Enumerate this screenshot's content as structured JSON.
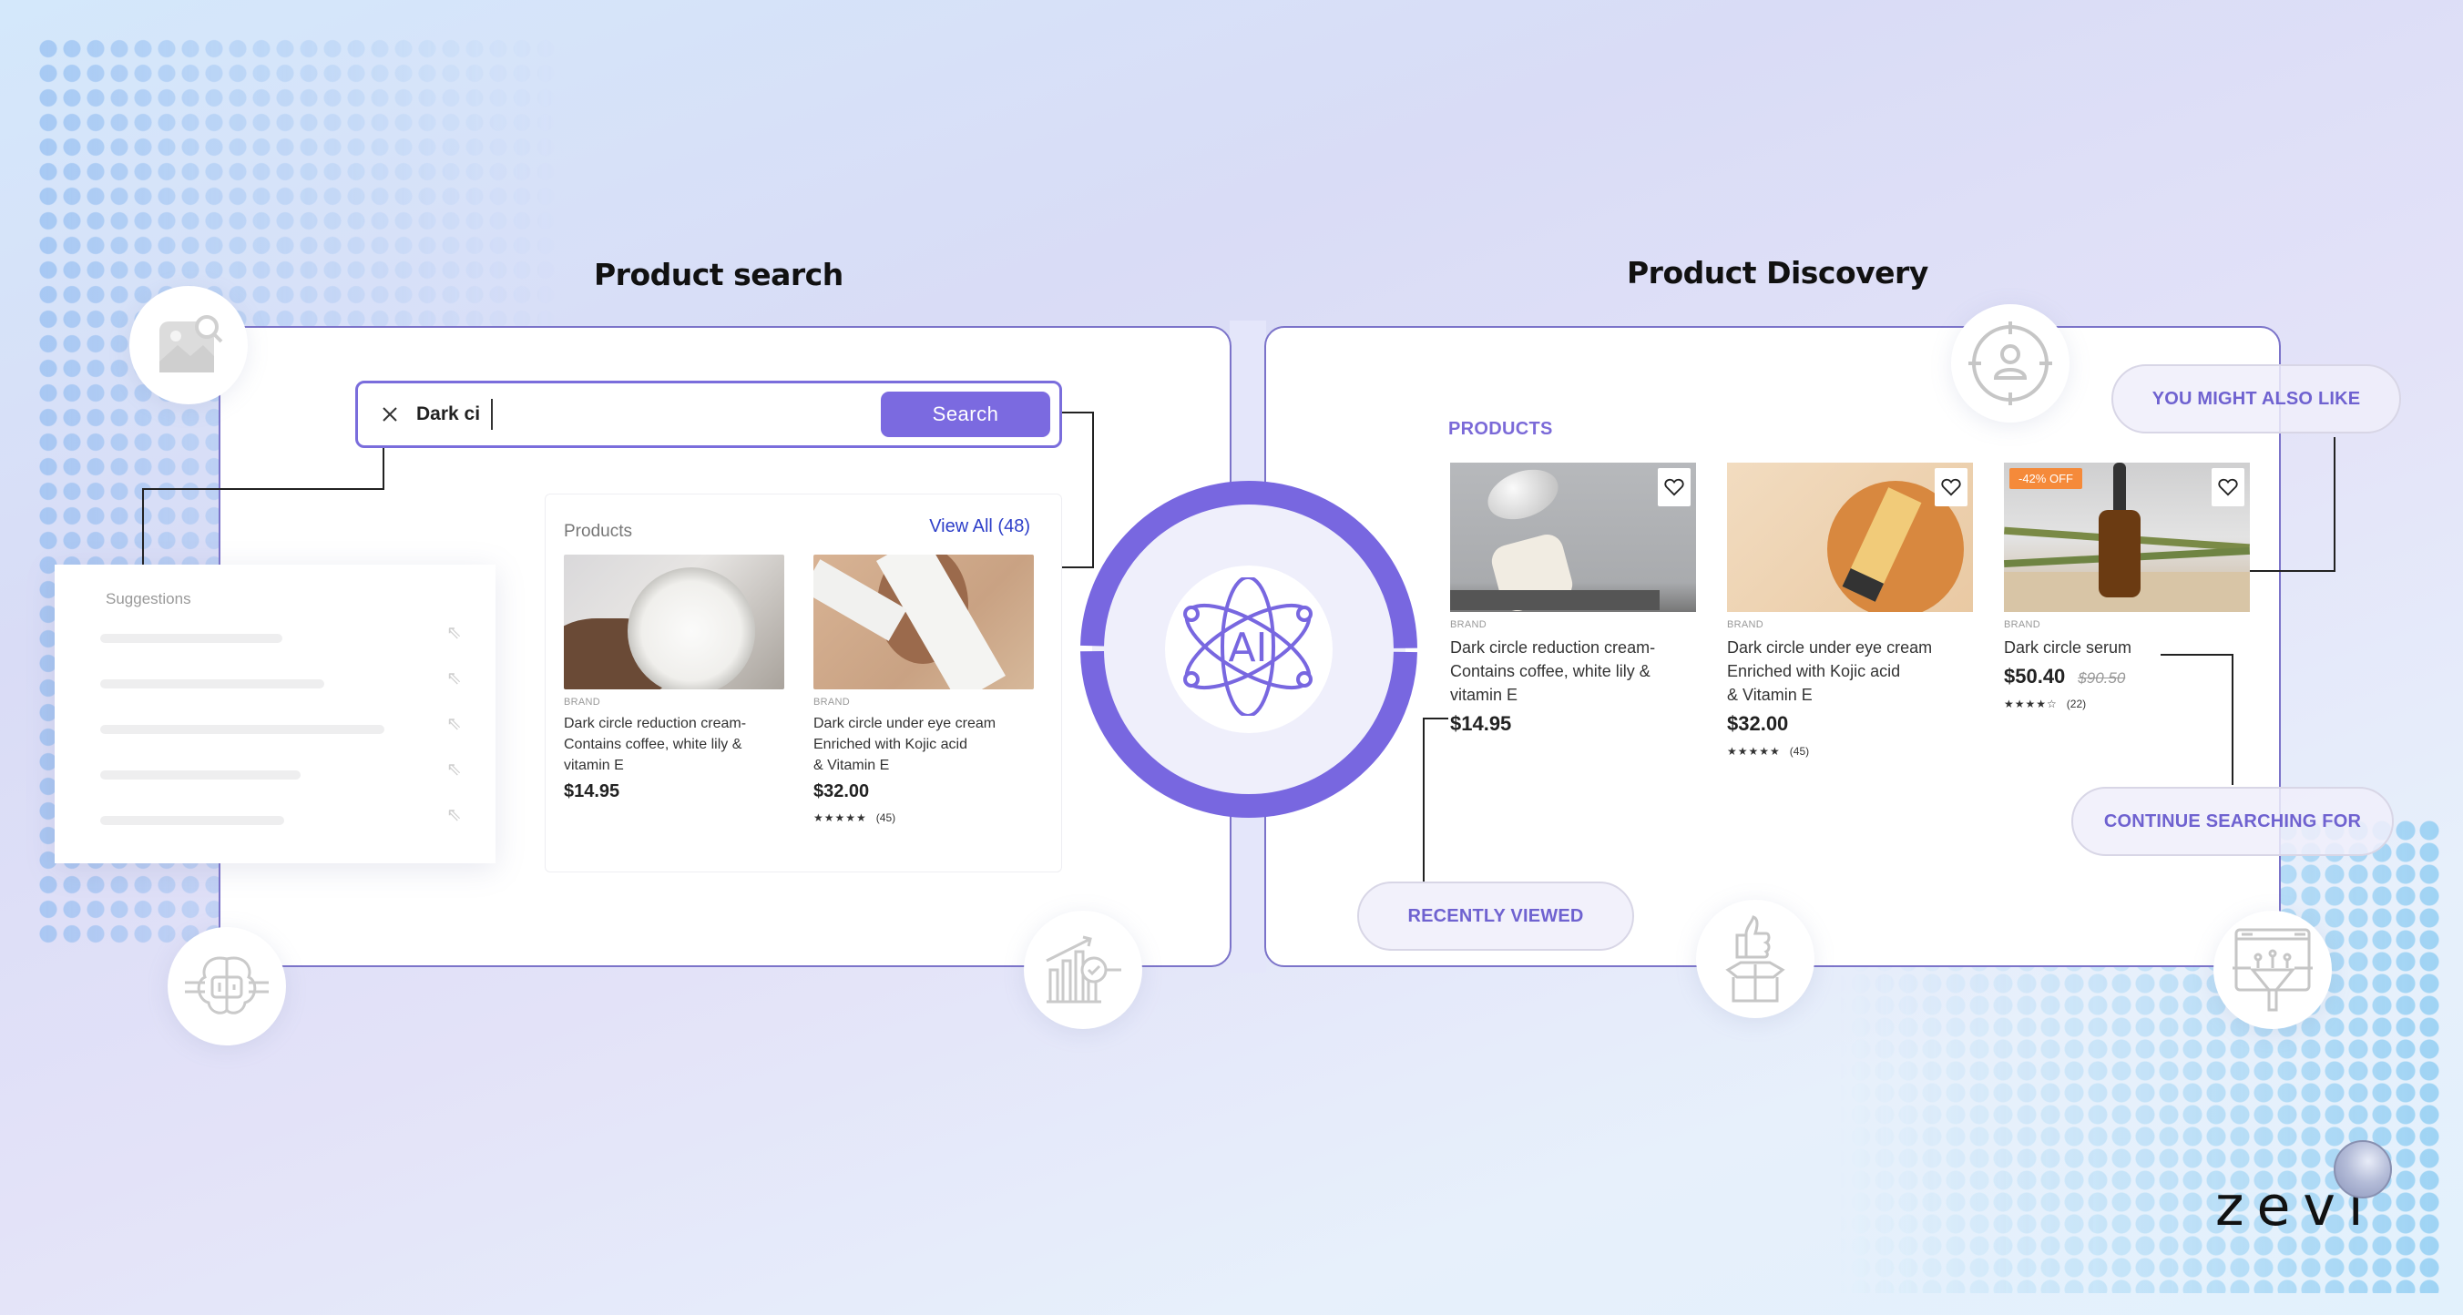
{
  "colors": {
    "accent": "#7b6ae0",
    "panel_border": "#7b73c9",
    "link": "#2e3fc9",
    "discount_badge": "#f58a3a",
    "icon_gray": "#c8c8cc"
  },
  "product_search": {
    "title": "Product search",
    "search": {
      "value": "Dark ci",
      "clear_icon": "close-icon",
      "button_label": "Search"
    },
    "suggestions": {
      "title": "Suggestions",
      "items": [
        {
          "placeholder_fill": 0.42,
          "icon": "arrow-up-left-icon"
        },
        {
          "placeholder_fill": 0.51,
          "icon": "arrow-up-left-icon"
        },
        {
          "placeholder_fill": 0.65,
          "icon": "arrow-up-left-icon"
        },
        {
          "placeholder_fill": 0.45,
          "icon": "arrow-up-left-icon"
        },
        {
          "placeholder_fill": 0.42,
          "icon": "arrow-up-left-icon"
        }
      ]
    },
    "products": {
      "title": "Products",
      "view_all": "View All (48)",
      "items": [
        {
          "brand": "BRAND",
          "name_lines": [
            "Dark circle reduction cream-",
            "Contains coffee, white lily &",
            "vitamin E"
          ],
          "price": "$14.95"
        },
        {
          "brand": "BRAND",
          "name_lines": [
            "Dark circle under eye cream",
            "Enriched with Kojic acid",
            "& Vitamin E"
          ],
          "price": "$32.00",
          "stars": "★★★★★",
          "rating": 5,
          "reviews": "(45)"
        }
      ]
    },
    "icons": [
      "image-search-icon",
      "ai-brain-icon",
      "analytics-search-icon"
    ]
  },
  "center": {
    "label": "AI",
    "icon": "ai-atom-icon"
  },
  "product_discovery": {
    "title": "Product Discovery",
    "section_label": "PRODUCTS",
    "items": [
      {
        "brand": "BRAND",
        "name_lines": [
          "Dark circle reduction cream-",
          "Contains coffee, white lily &",
          "vitamin E"
        ],
        "price": "$14.95"
      },
      {
        "brand": "BRAND",
        "name_lines": [
          "Dark circle under eye cream",
          "Enriched with Kojic acid",
          "& Vitamin E"
        ],
        "price": "$32.00",
        "stars": "★★★★★",
        "rating": 5,
        "reviews": "(45)"
      },
      {
        "badge": "-42% OFF",
        "brand": "BRAND",
        "name_lines": [
          "Dark circle serum"
        ],
        "price": "$50.40",
        "old_price": "$90.50",
        "stars": "★★★★☆",
        "rating": 4,
        "reviews": "(22)"
      }
    ],
    "pills": {
      "you_might_also_like": "YOU MIGHT ALSO LIKE",
      "continue_searching_for": "CONTINUE SEARCHING FOR",
      "recently_viewed": "RECENTLY VIEWED"
    },
    "icons": [
      "user-target-icon",
      "thumbs-up-box-icon",
      "browser-funnel-icon"
    ]
  },
  "brand": {
    "logo_text": "zevi"
  }
}
